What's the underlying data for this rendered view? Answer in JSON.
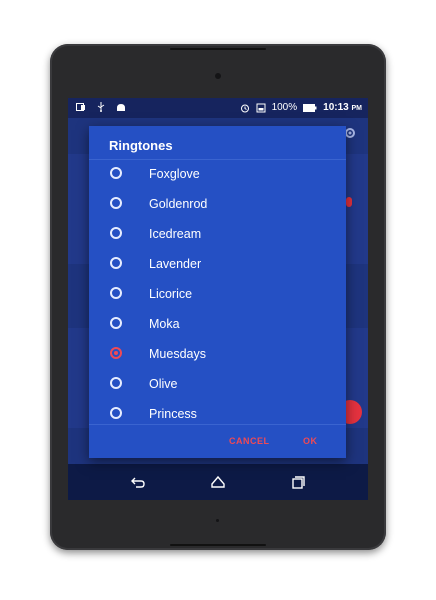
{
  "status_bar": {
    "battery_text": "100%",
    "time": "10:13",
    "time_suffix": "PM"
  },
  "dialog": {
    "title": "Ringtones",
    "options": [
      {
        "label": "Foxglove",
        "checked": false
      },
      {
        "label": "Goldenrod",
        "checked": false
      },
      {
        "label": "Icedream",
        "checked": false
      },
      {
        "label": "Lavender",
        "checked": false
      },
      {
        "label": "Licorice",
        "checked": false
      },
      {
        "label": "Moka",
        "checked": false
      },
      {
        "label": "Muesdays",
        "checked": true
      },
      {
        "label": "Olive",
        "checked": false
      },
      {
        "label": "Princess",
        "checked": false
      }
    ],
    "cancel_label": "CANCEL",
    "ok_label": "OK"
  },
  "colors": {
    "accent": "#ef4a55",
    "dialog_bg": "#2550c4",
    "app_bg": "#1e347e"
  }
}
